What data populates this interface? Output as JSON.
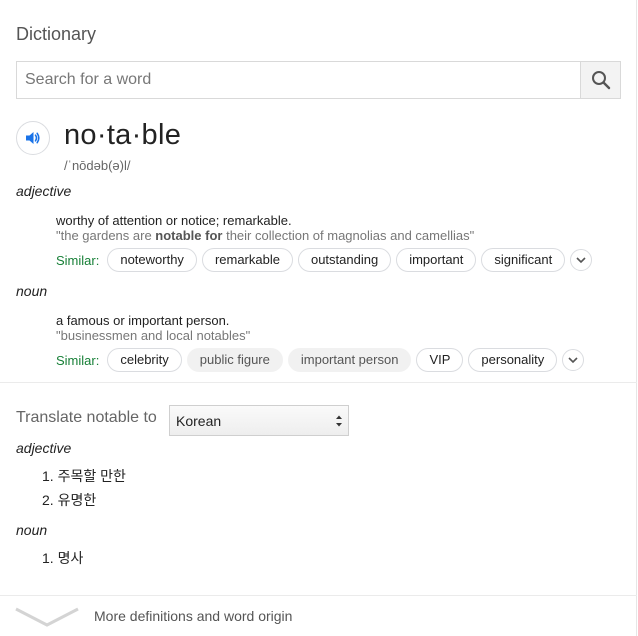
{
  "title": "Dictionary",
  "search": {
    "placeholder": "Search for a word",
    "value": ""
  },
  "entry": {
    "word": "no·ta·ble",
    "phonetic": "/ˈnōdəb(ə)l/",
    "senses": [
      {
        "pos": "adjective",
        "definition": "worthy of attention or notice; remarkable.",
        "example_before": "\"the gardens are ",
        "example_bold": "notable for",
        "example_after": " their collection of magnolias and camellias\"",
        "similar_label": "Similar:",
        "similar": [
          "noteworthy",
          "remarkable",
          "outstanding",
          "important",
          "significant"
        ]
      },
      {
        "pos": "noun",
        "definition": "a famous or important person.",
        "example": "\"businessmen and local notables\"",
        "similar_label": "Similar:",
        "similar": [
          "celebrity",
          "public figure",
          "important person",
          "VIP",
          "personality"
        ]
      }
    ]
  },
  "translate": {
    "label": "Translate notable to",
    "language": "Korean",
    "groups": [
      {
        "pos": "adjective",
        "items": [
          "1. 주목할 만한",
          "2. 유명한"
        ]
      },
      {
        "pos": "noun",
        "items": [
          "1. 명사"
        ]
      }
    ]
  },
  "footer": {
    "more_text": "More definitions and word origin"
  },
  "icons": {
    "search": "search-icon",
    "speaker": "speaker-icon",
    "expand": "chevron-down-icon"
  },
  "colors": {
    "similar_label": "#188038",
    "speaker": "#1a73e8"
  }
}
